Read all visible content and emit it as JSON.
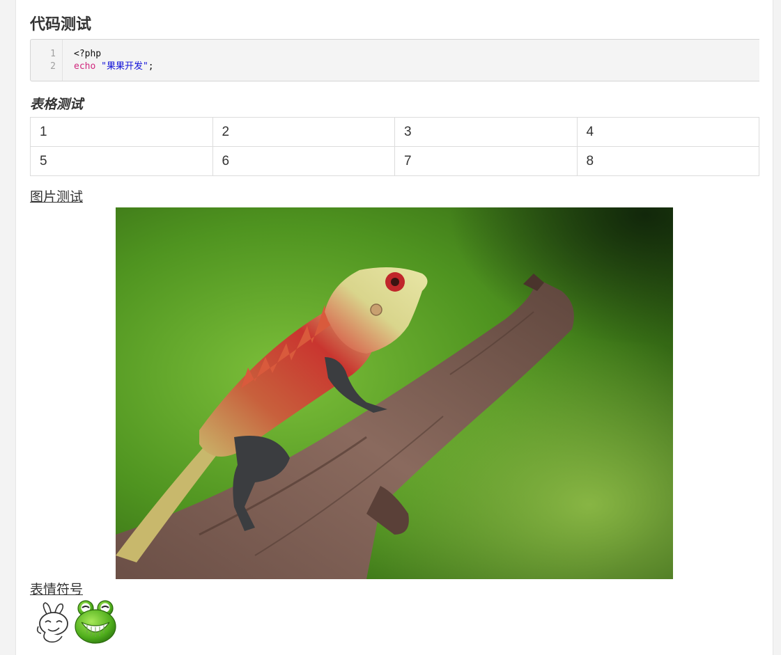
{
  "headings": {
    "code": "代码测试",
    "table": "表格测试",
    "image": "图片测试",
    "emoji": "表情符号"
  },
  "code_block": {
    "line_numbers": [
      "1",
      "2"
    ],
    "line1": "<?php",
    "line2_keyword": "echo",
    "line2_string": "\"果果开发\"",
    "line2_end": ";"
  },
  "table": {
    "rows": [
      [
        "1",
        "2",
        "3",
        "4"
      ],
      [
        "5",
        "6",
        "7",
        "8"
      ]
    ]
  },
  "image": {
    "alt": "lizard on a branch"
  },
  "emoji": {
    "items": [
      "doodle-rabbit-emoji-icon",
      "green-frog-grin-emoji-icon"
    ]
  }
}
